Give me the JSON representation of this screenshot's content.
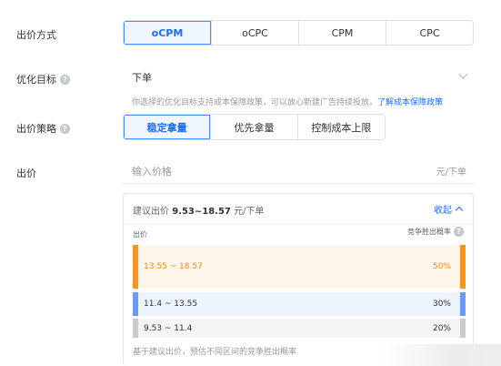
{
  "bid_method": {
    "label": "出价方式",
    "options": [
      "oCPM",
      "oCPC",
      "CPM",
      "CPC"
    ],
    "selected": 0
  },
  "optimize_goal": {
    "label": "优化目标",
    "value": "下单",
    "note": "你选择的优化目标支持成本保障政策，可以放心新建广告持续投放。",
    "note_link": "了解成本保障政策"
  },
  "bid_strategy": {
    "label": "出价策略",
    "options": [
      "稳定拿量",
      "优先拿量",
      "控制成本上限"
    ],
    "selected": 0
  },
  "bid": {
    "label": "出价",
    "placeholder": "输入价格",
    "unit": "元/下单"
  },
  "suggest_panel": {
    "prefix": "建议出价",
    "range": "9.53~18.57",
    "unit": "元/下单",
    "collapse_label": "收起",
    "col_left": "出价",
    "col_right": "竞争胜出概率",
    "bands": [
      {
        "range": "13.55 ~ 18.57",
        "prob": "50%",
        "prob_value": 0.5
      },
      {
        "range": "11.4 ~ 13.55",
        "prob": "30%",
        "prob_value": 0.3
      },
      {
        "range": "9.53 ~ 11.4",
        "prob": "20%",
        "prob_value": 0.2
      }
    ],
    "footer": "基于建议出价，预估不同区间的竞争胜出概率"
  },
  "colors": {
    "accent": "#1f6ff0",
    "band_high": "#f7931e",
    "band_mid": "#6b9cf5",
    "band_low": "#c8cbd0"
  }
}
